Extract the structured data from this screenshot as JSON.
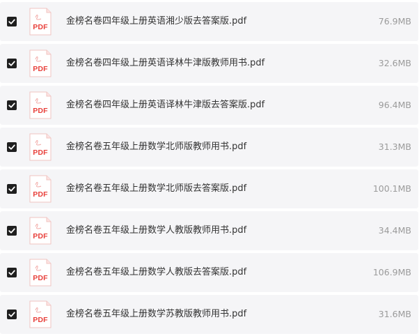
{
  "icons": {
    "checkbox": "checkbox-checked-icon",
    "file": "pdf-file-icon",
    "file_badge_text": "PDF",
    "accent_color": "#e8403b"
  },
  "files": [
    {
      "name": "金榜名卷四年级上册英语湘少版去答案版.pdf",
      "size": "76.9MB",
      "checked": true
    },
    {
      "name": "金榜名卷四年级上册英语译林牛津版教师用书.pdf",
      "size": "32.6MB",
      "checked": true
    },
    {
      "name": "金榜名卷四年级上册英语译林牛津版去答案版.pdf",
      "size": "96.4MB",
      "checked": true
    },
    {
      "name": "金榜名卷五年级上册数学北师版教师用书.pdf",
      "size": "31.3MB",
      "checked": true
    },
    {
      "name": "金榜名卷五年级上册数学北师版去答案版.pdf",
      "size": "100.1MB",
      "checked": true
    },
    {
      "name": "金榜名卷五年级上册数学人教版教师用书.pdf",
      "size": "34.4MB",
      "checked": true
    },
    {
      "name": "金榜名卷五年级上册数学人教版去答案版.pdf",
      "size": "106.9MB",
      "checked": true
    },
    {
      "name": "金榜名卷五年级上册数学苏教版教师用书.pdf",
      "size": "31.6MB",
      "checked": true
    }
  ]
}
